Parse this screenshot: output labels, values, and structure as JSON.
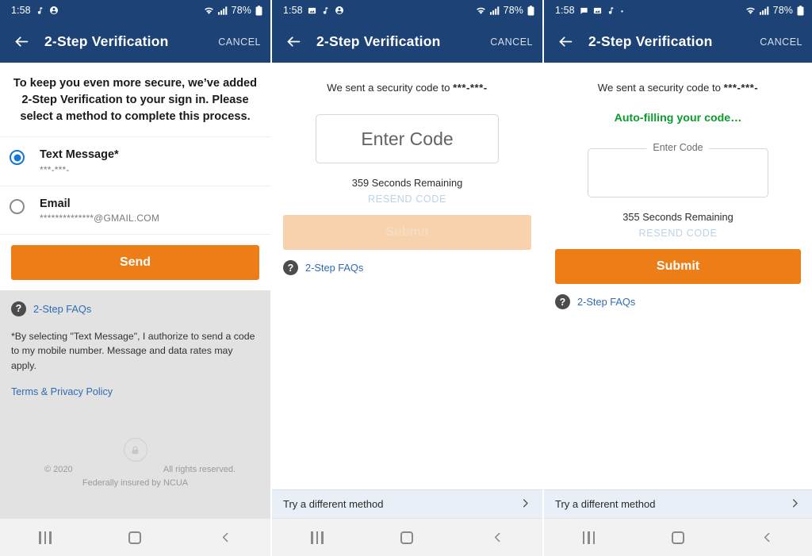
{
  "theme": {
    "header_bg": "#1d4275",
    "orange": "#ed7d17",
    "orange_disabled": "#f7d2ad",
    "link_blue": "#2e6bb5",
    "radio_blue": "#1577d2",
    "gray_panel": "#e2e2e2",
    "try_bar_bg": "#e8eff7",
    "green": "#0b9b2e"
  },
  "panels": [
    {
      "status_bar": {
        "time": "1:58",
        "icons": [
          "music-note-icon",
          "account-circle-icon"
        ],
        "wifi": "wifi-icon",
        "signal": "signal-bars-icon",
        "battery_pct": "78%",
        "battery": "battery-icon"
      },
      "app_bar": {
        "back": "back-arrow-icon",
        "title": "2-Step Verification",
        "cancel_label": "CANCEL"
      },
      "intro": "To keep you even more secure, we’ve added 2-Step Verification to your sign in. Please select a method to complete this process.",
      "methods": [
        {
          "label": "Text Message*",
          "detail": "***-***-",
          "selected": true
        },
        {
          "label": "Email",
          "detail": "**************@GMAIL.COM",
          "selected": false
        }
      ],
      "primary_button": "Send",
      "faq_label": "2-Step FAQs",
      "faq_icon": "question-mark-icon",
      "disclaimer": "*By selecting \"Text Message\", I authorize to send a code to my mobile number. Message and data rates may apply.",
      "terms_link": "Terms & Privacy Policy",
      "footer": {
        "lock_icon": "lock-icon",
        "copyright": "© 2020",
        "rights": "All rights reserved.",
        "ncua": "Federally insured by NCUA"
      },
      "nav": {
        "recents": "recents-icon",
        "home": "home-icon",
        "back": "back-chevron-icon"
      }
    },
    {
      "status_bar": {
        "time": "1:58",
        "icons": [
          "image-icon",
          "music-note-icon",
          "account-circle-icon"
        ],
        "wifi": "wifi-icon",
        "signal": "signal-bars-icon",
        "battery_pct": "78%",
        "battery": "battery-icon"
      },
      "app_bar": {
        "back": "back-arrow-icon",
        "title": "2-Step Verification",
        "cancel_label": "CANCEL"
      },
      "sent_prefix": "We sent a security code to ",
      "sent_target": "***-***-",
      "code_placeholder": "Enter Code",
      "code_value": "",
      "seconds_remaining": "359 Seconds Remaining",
      "resend_label": "RESEND CODE",
      "primary_button": "Submit",
      "primary_button_disabled": true,
      "faq_label": "2-Step FAQs",
      "faq_icon": "question-mark-icon",
      "try_label": "Try a different method",
      "try_chevron": "chevron-right-icon",
      "nav": {
        "recents": "recents-icon",
        "home": "home-icon",
        "back": "back-chevron-icon"
      }
    },
    {
      "status_bar": {
        "time": "1:58",
        "icons": [
          "message-bubble-icon",
          "image-icon",
          "music-note-icon",
          "dot-icon"
        ],
        "wifi": "wifi-icon",
        "signal": "signal-bars-icon",
        "battery_pct": "78%",
        "battery": "battery-icon"
      },
      "app_bar": {
        "back": "back-arrow-icon",
        "title": "2-Step Verification",
        "cancel_label": "CANCEL"
      },
      "sent_prefix": "We sent a security code to ",
      "sent_target": "***-***-",
      "autofill_status": "Auto-filling your code…",
      "code_label": "Enter Code",
      "code_value": "",
      "seconds_remaining": "355 Seconds Remaining",
      "resend_label": "RESEND CODE",
      "primary_button": "Submit",
      "primary_button_disabled": false,
      "faq_label": "2-Step FAQs",
      "faq_icon": "question-mark-icon",
      "try_label": "Try a different method",
      "try_chevron": "chevron-right-icon",
      "nav": {
        "recents": "recents-icon",
        "home": "home-icon",
        "back": "back-chevron-icon"
      }
    }
  ]
}
